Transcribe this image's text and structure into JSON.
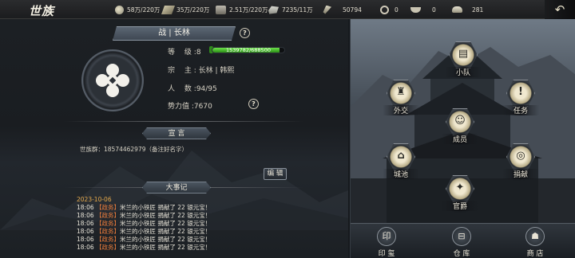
{
  "header": {
    "logo_text": "世族",
    "resources": [
      {
        "icon": "coin-icon",
        "value": "58万/220万"
      },
      {
        "icon": "wood-icon",
        "value": "35万/220万"
      },
      {
        "icon": "stone-icon",
        "value": "2.51万/220万"
      },
      {
        "icon": "iron-icon",
        "value": "7235/11万"
      },
      {
        "icon": "feather-icon",
        "value": "50794"
      },
      {
        "icon": "ring-icon",
        "value": "0"
      },
      {
        "icon": "bowl-icon",
        "value": "0"
      },
      {
        "icon": "ingot-icon",
        "value": "281"
      }
    ],
    "close_glyph": "↶"
  },
  "clan": {
    "name": "战 | 长林",
    "help_glyph": "?",
    "level_label": "等",
    "level_label2": "级",
    "level_value": ":8",
    "exp_text": "1539782/688500",
    "exp_fraction": 0.93,
    "lord_label": "宗",
    "lord_label2": "主",
    "lord_value": ": 长林 | 韩熙",
    "members_label": "人",
    "members_label2": "数",
    "members_value": ":94/95",
    "power_label": "势力值",
    "power_value": ":7670"
  },
  "declaration": {
    "title": "宣 言",
    "text": "世族群：18574462979（备注好名字）",
    "edit_label": "编 辑"
  },
  "events": {
    "title": "大事记",
    "date": "2023-10-06",
    "rows": [
      {
        "time": "18:06",
        "tag": "【政务】",
        "text": "米兰的小铁匠 捐献了 22 银元宝！"
      },
      {
        "time": "18:06",
        "tag": "【政务】",
        "text": "米兰的小铁匠 捐献了 22 银元宝！"
      },
      {
        "time": "18:06",
        "tag": "【政务】",
        "text": "米兰的小铁匠 捐献了 22 银元宝！"
      },
      {
        "time": "18:06",
        "tag": "【政务】",
        "text": "米兰的小铁匠 捐献了 22 银元宝！"
      },
      {
        "time": "18:06",
        "tag": "【政务】",
        "text": "米兰的小铁匠 捐献了 22 银元宝！"
      },
      {
        "time": "18:06",
        "tag": "【政务】",
        "text": "米兰的小铁匠 捐献了 22 银元宝！"
      }
    ]
  },
  "map_nodes": [
    {
      "key": "squad",
      "label": "小队",
      "glyph": "▤"
    },
    {
      "key": "diplomacy",
      "label": "外交",
      "glyph": "♜"
    },
    {
      "key": "tasks",
      "label": "任务",
      "glyph": "!"
    },
    {
      "key": "members",
      "label": "成员",
      "glyph": "☺"
    },
    {
      "key": "city",
      "label": "城池",
      "glyph": "⌂"
    },
    {
      "key": "donate",
      "label": "捐献",
      "glyph": "◎"
    },
    {
      "key": "ranks",
      "label": "官爵",
      "glyph": "✦"
    }
  ],
  "bottom_buttons": [
    {
      "key": "seal",
      "label": "印 玺",
      "glyph": "印"
    },
    {
      "key": "warehouse",
      "label": "仓 库",
      "glyph": "⊟"
    },
    {
      "key": "shop",
      "label": "商 店",
      "glyph": "☗"
    }
  ]
}
